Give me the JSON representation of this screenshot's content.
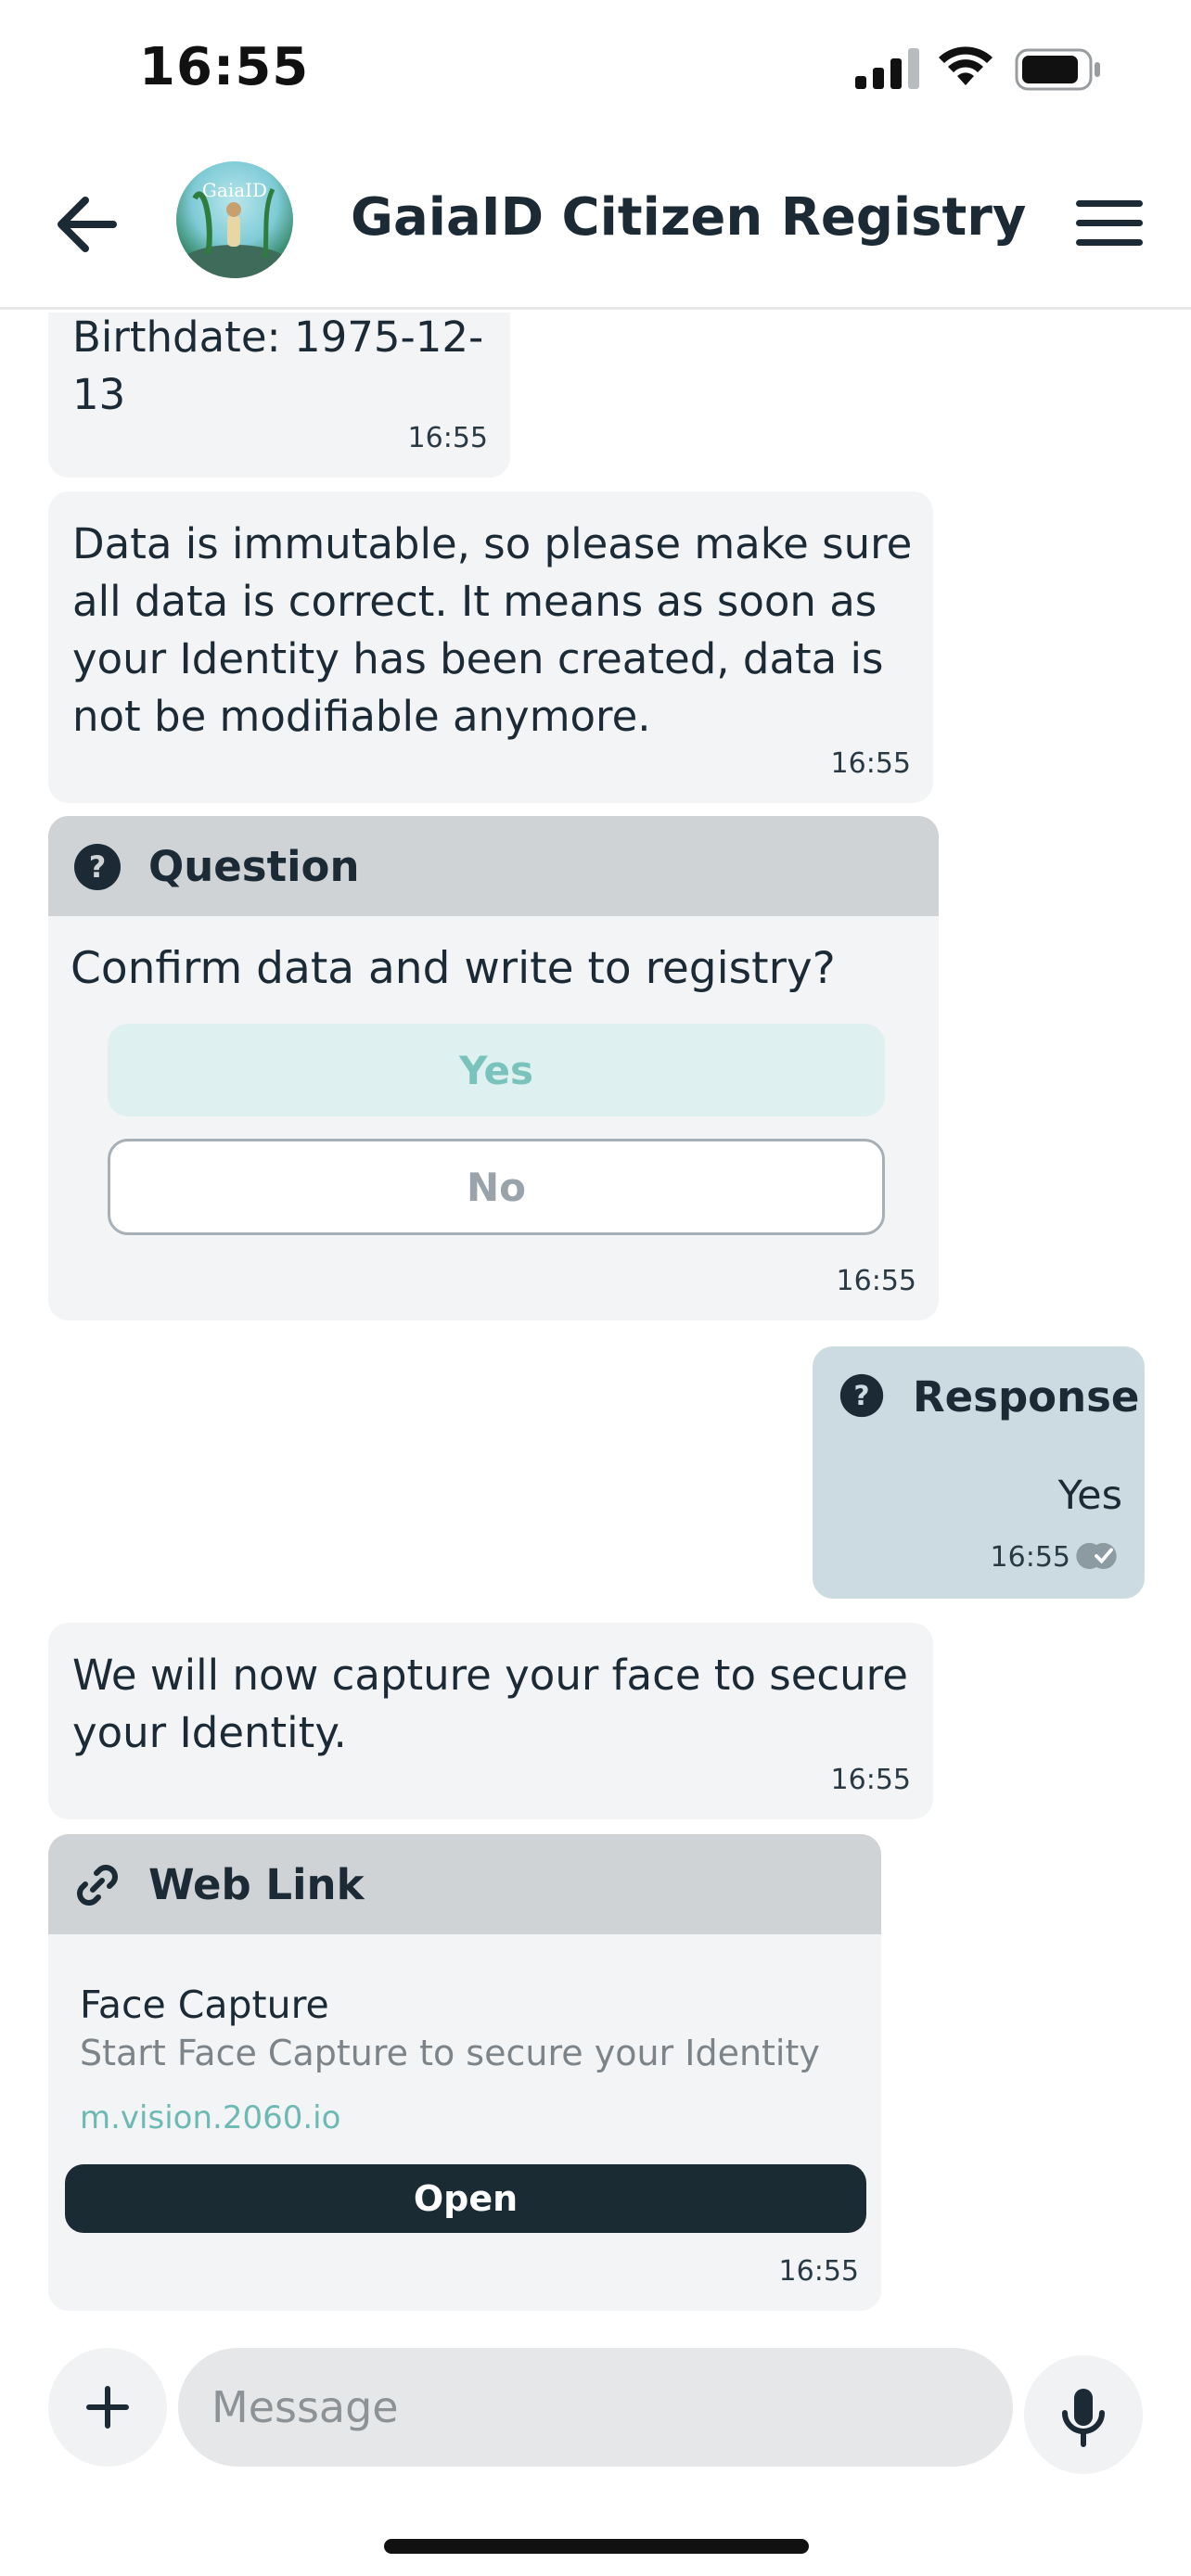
{
  "status_bar": {
    "time": "16:55"
  },
  "header": {
    "title": "GaiaID Citizen Registry",
    "avatar_text": "GaiaID"
  },
  "messages": {
    "birthdate": {
      "text": "Birthdate: 1975-12-13",
      "time": "16:55"
    },
    "immutable": {
      "lines": [
        "Data is immutable, so please make sure",
        "all data is correct. It means as soon as",
        "your Identity has been created, data is",
        "not be modifiable anymore."
      ],
      "time": "16:55"
    },
    "question": {
      "header": "Question",
      "text": "Confirm data and write to registry?",
      "yes_label": "Yes",
      "no_label": "No",
      "time": "16:55"
    },
    "response": {
      "header": "Response",
      "answer": "Yes",
      "time": "16:55"
    },
    "face": {
      "lines": [
        "We will now capture your face to secure",
        "your Identity."
      ],
      "time": "16:55"
    },
    "weblink": {
      "header": "Web Link",
      "title": "Face Capture",
      "description": "Start Face Capture to secure your Identity",
      "url": "m.vision.2060.io",
      "button_label": "Open",
      "time": "16:55"
    }
  },
  "composer": {
    "placeholder": "Message"
  },
  "icons": {
    "back": "arrow-left-icon",
    "menu": "hamburger-menu-icon",
    "question": "question-circle-icon",
    "link": "link-icon",
    "plus": "plus-icon",
    "mic": "microphone-icon",
    "read": "double-check-icon"
  },
  "colors": {
    "accent": "#6db9b3",
    "dark": "#1a2b34",
    "bubble": "#f3f4f6",
    "response_bubble": "#ccdbe2",
    "card_header": "#cfd3d6"
  }
}
